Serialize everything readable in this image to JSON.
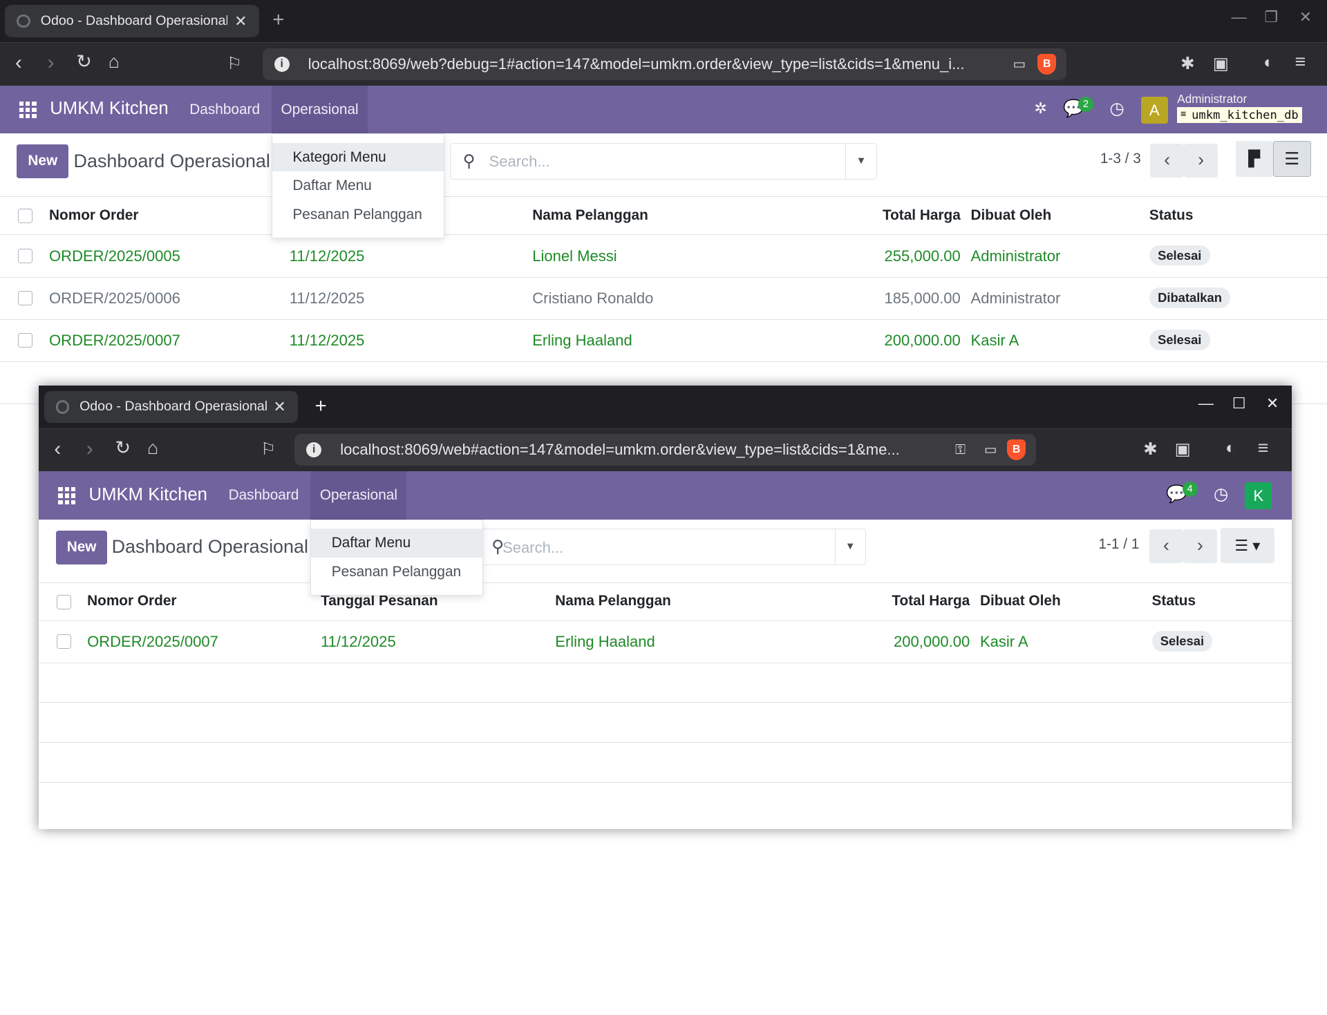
{
  "w1": {
    "browser": {
      "tab_title": "Odoo - Dashboard Operasional",
      "url": "localhost:8069/web?debug=1#action=147&model=umkm.order&view_type=list&cids=1&menu_i..."
    },
    "app": {
      "brand": "UMKM Kitchen",
      "menu_dashboard": "Dashboard",
      "menu_operasional": "Operasional",
      "chat_count": "2",
      "user_initial": "A",
      "user_name": "Administrator",
      "db_name": "umkm_kitchen_db"
    },
    "control": {
      "new_label": "New",
      "breadcrumb": "Dashboard Operasional",
      "search_placeholder": "Search...",
      "pager": "1-3 / 3"
    },
    "dropdown": [
      "Kategori Menu",
      "Daftar Menu",
      "Pesanan Pelanggan"
    ],
    "table": {
      "headers": {
        "nomor": "Nomor Order",
        "nama": "Nama Pelanggan",
        "total": "Total Harga",
        "dibuat": "Dibuat Oleh",
        "status": "Status"
      },
      "rows": [
        {
          "nomor": "ORDER/2025/0005",
          "tanggal": "11/12/2025",
          "nama": "Lionel Messi",
          "total": "255,000.00",
          "dibuat": "Administrator",
          "status": "Selesai"
        },
        {
          "nomor": "ORDER/2025/0006",
          "tanggal": "11/12/2025",
          "nama": "Cristiano Ronaldo",
          "total": "185,000.00",
          "dibuat": "Administrator",
          "status": "Dibatalkan"
        },
        {
          "nomor": "ORDER/2025/0007",
          "tanggal": "11/12/2025",
          "nama": "Erling Haaland",
          "total": "200,000.00",
          "dibuat": "Kasir A",
          "status": "Selesai"
        }
      ]
    }
  },
  "w2": {
    "browser": {
      "tab_title": "Odoo - Dashboard Operasional",
      "url": "localhost:8069/web#action=147&model=umkm.order&view_type=list&cids=1&me..."
    },
    "app": {
      "brand": "UMKM Kitchen",
      "menu_dashboard": "Dashboard",
      "menu_operasional": "Operasional",
      "chat_count": "4",
      "user_initial": "K"
    },
    "control": {
      "new_label": "New",
      "breadcrumb": "Dashboard Operasional",
      "search_placeholder": "Search...",
      "pager": "1-1 / 1"
    },
    "dropdown": [
      "Daftar Menu",
      "Pesanan Pelanggan"
    ],
    "table": {
      "headers": {
        "nomor": "Nomor Order",
        "tanggal": "Tanggal Pesanan",
        "nama": "Nama Pelanggan",
        "total": "Total Harga",
        "dibuat": "Dibuat Oleh",
        "status": "Status"
      },
      "rows": [
        {
          "nomor": "ORDER/2025/0007",
          "tanggal": "11/12/2025",
          "nama": "Erling Haaland",
          "total": "200,000.00",
          "dibuat": "Kasir A",
          "status": "Selesai"
        }
      ]
    }
  },
  "colors": {
    "odoo_purple": "#71639e",
    "link_green": "#1e8a27"
  }
}
